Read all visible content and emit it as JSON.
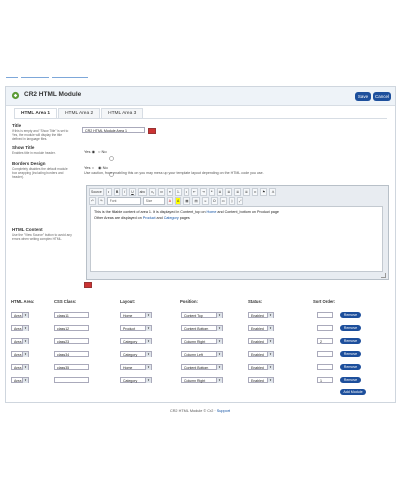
{
  "header": {
    "title": "CR2 HTML Module",
    "save_label": "Save",
    "cancel_label": "Cancel"
  },
  "tabs": [
    "HTML Area 1",
    "HTML Area 2",
    "HTML Area 3"
  ],
  "form": {
    "title_label": "Title",
    "title_help": "If this is empty and \"Show Title\" is set to Yes, the module will display the title defined in language files.",
    "title_value": "CR2 HTML Module Area 1",
    "show_title_label": "Show Title",
    "show_title_help": "Enables title in module header.",
    "show_title_yes": "Yes",
    "show_title_no": "No",
    "borders_label": "Borders Design",
    "borders_help": "Completely disables the default module box wrapping (including borders and header).",
    "borders_yes": "Yes",
    "borders_no": "No",
    "borders_hint": "Use caution, from enabling this on you may mess up your template layout depending on the HTML code you use.",
    "html_content_label": "HTML Content",
    "html_content_help": "Use the \"View Source\" button to avoid any errors when writing complex HTML."
  },
  "editor": {
    "toolbar1": [
      "Source",
      "◐",
      "B",
      "I",
      "U",
      "abc",
      "x₂",
      "x²",
      "≡",
      "1.",
      "•",
      "⇤",
      "⇥",
      "❝",
      "≣",
      "≣",
      "≣",
      "≣",
      "∞",
      "⚑",
      "⚓"
    ],
    "toolbar2_format": "Font",
    "toolbar2_size": "Size",
    "toolbar2_icons": [
      "A",
      "A",
      "▦",
      "▤",
      "☺",
      "Ω",
      "▭",
      "▯",
      "⤢"
    ],
    "undo": "↶",
    "redo": "↷",
    "line1_a": "This is the fillable content of area 1. It is displayed in Content_top on ",
    "line1_link": "Home",
    "line1_b": " and Content_bottom on Product page",
    "line2_a": "Other Areas are displayed on ",
    "line2_link": "Product",
    "line2_mid": " and ",
    "line2_link2": "Category",
    "line2_b": " pages"
  },
  "table": {
    "headers": [
      "HTML Area:",
      "CSS Class:",
      "Layout:",
      "Position:",
      "Status:",
      "Sort Order:"
    ],
    "rows": [
      {
        "area": "Area 1",
        "css": "class11",
        "layout": "Home",
        "position": "Content Top",
        "status": "Enabled",
        "sort": ""
      },
      {
        "area": "Area 1",
        "css": "class12",
        "layout": "Product",
        "position": "Content Bottom",
        "status": "Enabled",
        "sort": ""
      },
      {
        "area": "Area 2",
        "css": "class23",
        "layout": "Category",
        "position": "Column Right",
        "status": "Enabled",
        "sort": "2"
      },
      {
        "area": "Area 3",
        "css": "class34",
        "layout": "Category",
        "position": "Column Left",
        "status": "Enabled",
        "sort": ""
      },
      {
        "area": "Area 3",
        "css": "class35",
        "layout": "Home",
        "position": "Content Bottom",
        "status": "Enabled",
        "sort": ""
      },
      {
        "area": "Area 1",
        "css": "",
        "layout": "Category",
        "position": "Column Right",
        "status": "Enabled",
        "sort": "1"
      }
    ],
    "remove_label": "Remove",
    "add_label": "Add Module"
  },
  "footer": {
    "text": "CR2 HTML Module © Cr2 · ",
    "link": "Support"
  },
  "colors": {
    "accent": "#1d4f9c",
    "link": "#0d4fa3"
  }
}
